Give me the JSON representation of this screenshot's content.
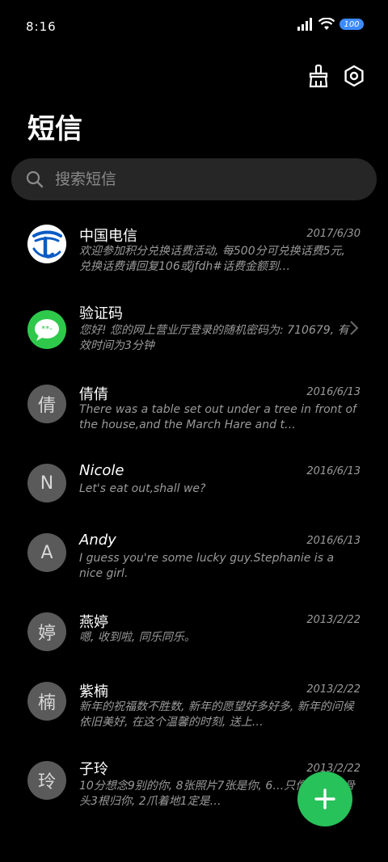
{
  "status_bar": {
    "time": "8:16",
    "battery": "100"
  },
  "header": {
    "title": "短信"
  },
  "search": {
    "placeholder": "搜索短信"
  },
  "conversations": [
    {
      "name": "中国电信",
      "date": "2017/6/30",
      "preview": "欢迎参加积分兑换话费活动, 每500分可兑换话费5元, 兑换话费请回复106或jfdh#话费金额到…",
      "avatar_text": "",
      "avatar_type": "china-telecom-logo"
    },
    {
      "name": "验证码",
      "date": "",
      "preview": "您好! 您的网上营业厅登录的随机密码为: 710679, 有效时间为3分钟",
      "avatar_text": "",
      "avatar_type": "message-bubble-icon"
    },
    {
      "name": "倩倩",
      "date": "2016/6/13",
      "preview": "There was a table set out under a tree in front of the house,and the March Hare and t…",
      "avatar_text": "倩"
    },
    {
      "name": "Nicole",
      "date": "2016/6/13",
      "preview": "Let's eat out,shall we?",
      "avatar_text": "N"
    },
    {
      "name": "Andy",
      "date": "2016/6/13",
      "preview": "I guess you're some lucky guy.Stephanie is a nice girl.",
      "avatar_text": "A"
    },
    {
      "name": "燕婷",
      "date": "2013/2/22",
      "preview": "嗯, 收到啦, 同乐同乐。",
      "avatar_text": "婷"
    },
    {
      "name": "紫楠",
      "date": "2013/2/22",
      "preview": "新年的祝福数不胜数, 新年的愿望好多好多, 新年的问候依旧美好, 在这个温馨的时刻, 送上…",
      "avatar_text": "楠"
    },
    {
      "name": "子玲",
      "date": "2013/2/22",
      "preview": "10分想念9别的你, 8张照片7张是你, 6…只像你, 4根骨头3根归你, 2爪着地1定是…",
      "avatar_text": "玲"
    }
  ],
  "colors": {
    "background": "#000000",
    "search_bg": "#262626",
    "fab": "#27c25a",
    "battery": "#3d8bff",
    "avatar_gray": "#5a5a5a",
    "telecom_blue": "#0a5bc4",
    "message_green": "#2ec94b"
  },
  "icons": {
    "clean": "broom-icon",
    "settings": "settings-hexagon-icon",
    "search": "search-icon",
    "fab": "plus-icon"
  }
}
